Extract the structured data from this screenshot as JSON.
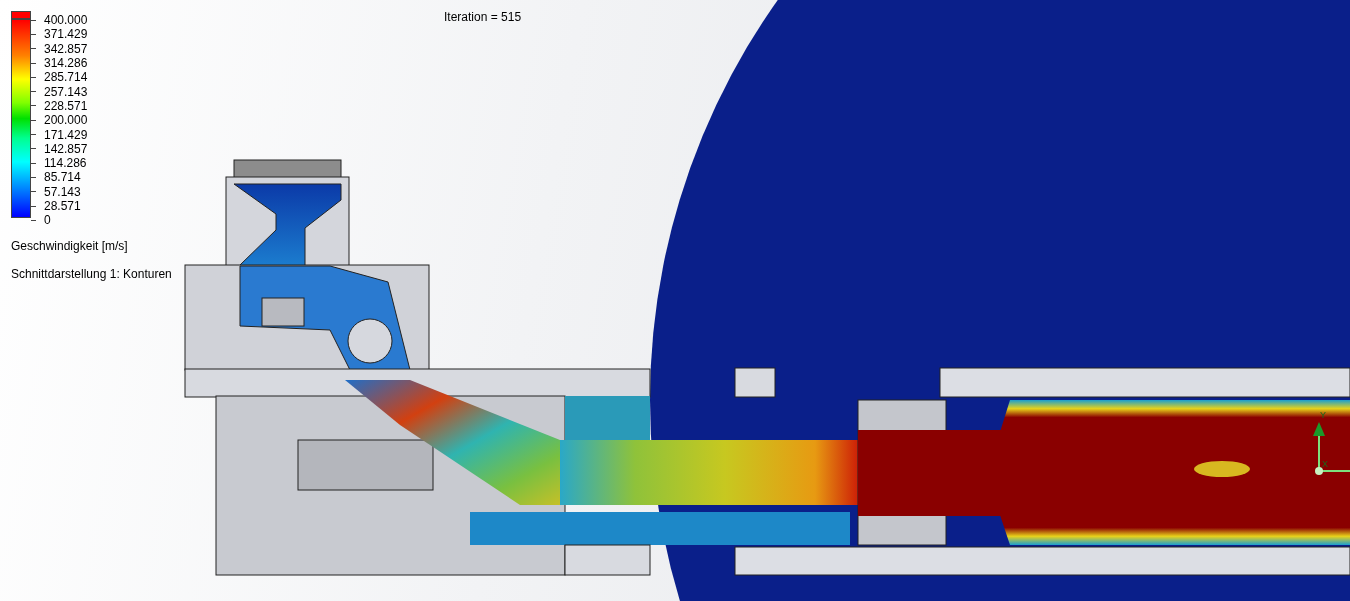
{
  "legend": {
    "ticks": [
      "400.000",
      "371.429",
      "342.857",
      "314.286",
      "285.714",
      "257.143",
      "228.571",
      "200.000",
      "171.429",
      "142.857",
      "114.286",
      "85.714",
      "57.143",
      "28.571",
      "0"
    ],
    "quantity": "Geschwindigkeit [m/s]",
    "plot": "Schnittdarstellung 1: Konturen"
  },
  "iteration": "Iteration = 515",
  "axes": {
    "y_label": "Y",
    "x_label": "X"
  }
}
